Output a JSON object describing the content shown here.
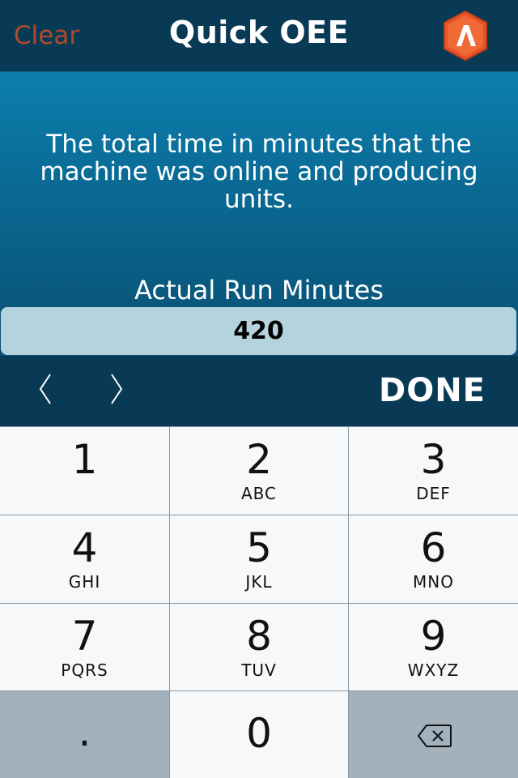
{
  "header": {
    "clear_label": "Clear",
    "title": "Quick OEE",
    "logo_icon": "a-logo-icon"
  },
  "main": {
    "description": "The total time in minutes that the machine was online and producing units.",
    "field_label": "Actual Run Minutes",
    "field_value": "420"
  },
  "accessory_bar": {
    "prev_icon": "chevron-left-icon",
    "next_icon": "chevron-right-icon",
    "done_label": "DONE"
  },
  "keypad": {
    "keys": [
      {
        "digit": "1",
        "letters": ""
      },
      {
        "digit": "2",
        "letters": "ABC"
      },
      {
        "digit": "3",
        "letters": "DEF"
      },
      {
        "digit": "4",
        "letters": "GHI"
      },
      {
        "digit": "5",
        "letters": "JKL"
      },
      {
        "digit": "6",
        "letters": "MNO"
      },
      {
        "digit": "7",
        "letters": "PQRS"
      },
      {
        "digit": "8",
        "letters": "TUV"
      },
      {
        "digit": "9",
        "letters": "WXYZ"
      }
    ],
    "dot_label": ".",
    "zero_label": "0",
    "delete_icon": "backspace-icon"
  },
  "colors": {
    "header_bg": "#083a56",
    "clear_text": "#b24a2a",
    "gradient_top": "#0c7fae",
    "gradient_bottom": "#0a4f72",
    "value_box": "#b5d3de",
    "logo_orange": "#e8542a",
    "key_light": "#f6f8f9",
    "key_dark": "#a3b1bc"
  }
}
